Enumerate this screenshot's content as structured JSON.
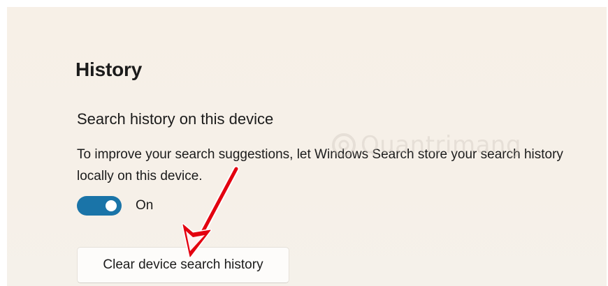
{
  "history": {
    "title": "History",
    "search_history": {
      "title": "Search history on this device",
      "description": "To improve your search suggestions, let Windows Search store your search history locally on this device.",
      "toggle_state": "On",
      "toggle_on": true
    },
    "clear_button_label": "Clear device search history"
  },
  "watermark": {
    "text": "Quantrimang"
  },
  "colors": {
    "accent": "#1a74a8",
    "background": "#f7f0e7",
    "annotation_arrow": "#e3000f"
  },
  "icons": {
    "annotation": "red-arrow-annotation",
    "watermark_logo": "quantrimang-logo"
  }
}
